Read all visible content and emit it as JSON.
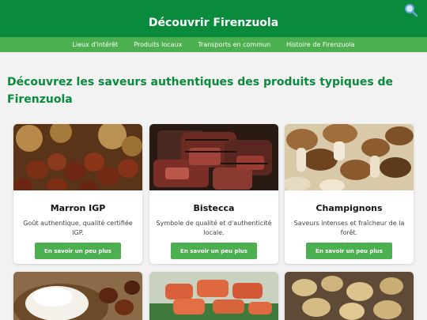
{
  "header": {
    "title": "Découvrir Firenzuola"
  },
  "nav": {
    "items": [
      "Lieux d'intérêt",
      "Produits locaux",
      "Transports en commun",
      "Histoire de Firenzuola"
    ]
  },
  "intro": "Découvrez les saveurs authentiques des produits typiques de Firenzuola",
  "cards": [
    {
      "title": "Marron IGP",
      "description": "Goût authentique, qualité certifiée IGP.",
      "button": "En savoir un peu plus"
    },
    {
      "title": "Bistecca",
      "description": "Symbole de qualité et d'authenticité locale.",
      "button": "En savoir un peu plus"
    },
    {
      "title": "Champignons",
      "description": "Saveurs intenses et fraîcheur de la forêt.",
      "button": "En savoir un peu plus"
    }
  ],
  "colors": {
    "header": "#0a8a3c",
    "nav": "#4caf50",
    "button": "#4caf50",
    "heading": "#0a8a3c"
  }
}
